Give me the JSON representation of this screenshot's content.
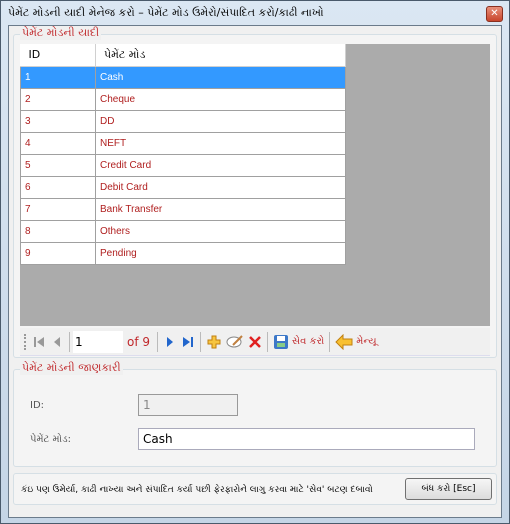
{
  "window": {
    "title": "પેમેંટ મોડની યાદી મેનેજ કરો – પેમેંટ મોડ ઉમેરો/સંપાદિત કરો/કાઢી નાખો",
    "close_icon": "close-icon"
  },
  "list_group": {
    "legend": "પેમેંટ મોડની યાદી",
    "columns": [
      "ID",
      "પેમેંટ મોડ"
    ],
    "rows": [
      {
        "id": "1",
        "mode": "Cash",
        "selected": true
      },
      {
        "id": "2",
        "mode": "Cheque"
      },
      {
        "id": "3",
        "mode": "DD"
      },
      {
        "id": "4",
        "mode": "NEFT"
      },
      {
        "id": "5",
        "mode": "Credit Card"
      },
      {
        "id": "6",
        "mode": "Debit Card"
      },
      {
        "id": "7",
        "mode": "Bank Transfer"
      },
      {
        "id": "8",
        "mode": "Others"
      },
      {
        "id": "9",
        "mode": "Pending"
      }
    ]
  },
  "navigator": {
    "position": "1",
    "of_label": "of 9",
    "save_label": "સેવ કરો",
    "menu_label": "મેન્યૂ"
  },
  "details_group": {
    "legend": "પેમેંટ મોડની જાણકારી",
    "id_label": "ID:",
    "id_value": "1",
    "mode_label": "પેમેંટ મોડ:",
    "mode_value": "Cash"
  },
  "footer": {
    "hint": "કંઇ પણ ઉમેર્યા, કાઢી નાખ્યા અને સંપાદિત કર્યા પછી ફેરફારોને લાગુ કરવા માટે 'સેવ' બટણ દબાવો",
    "close_button": "બંધ કરો [Esc]"
  }
}
